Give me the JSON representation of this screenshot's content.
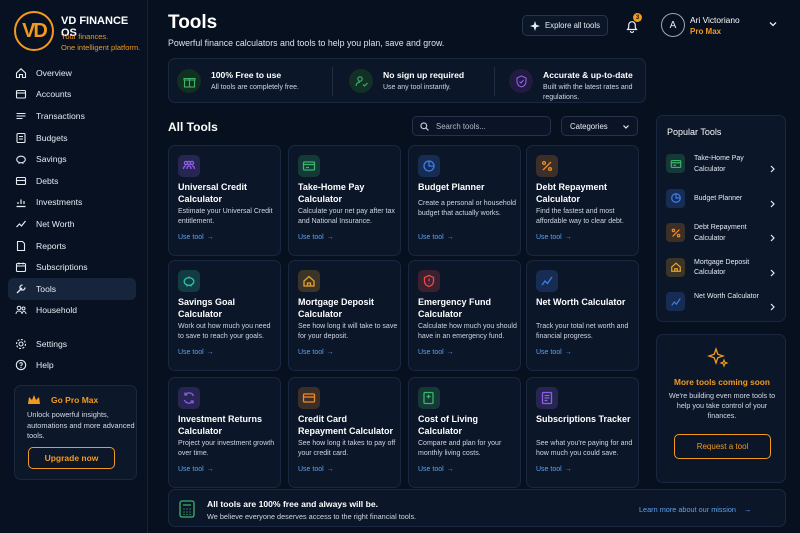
{
  "brand": {
    "logo": "VD",
    "name": "VD FINANCE OS",
    "tagline1": "Your finances.",
    "tagline2": "One intelligent platform."
  },
  "nav": [
    {
      "label": "Overview",
      "icon": "home-icon"
    },
    {
      "label": "Accounts",
      "icon": "wallet-icon"
    },
    {
      "label": "Transactions",
      "icon": "transactions-icon"
    },
    {
      "label": "Budgets",
      "icon": "budget-icon"
    },
    {
      "label": "Savings",
      "icon": "piggy-bank-icon"
    },
    {
      "label": "Debts",
      "icon": "debt-icon"
    },
    {
      "label": "Investments",
      "icon": "chart-icon"
    },
    {
      "label": "Net Worth",
      "icon": "networth-icon"
    },
    {
      "label": "Reports",
      "icon": "report-icon"
    },
    {
      "label": "Subscriptions",
      "icon": "calendar-icon"
    },
    {
      "label": "Tools",
      "icon": "wrench-icon",
      "active": true
    },
    {
      "label": "Household",
      "icon": "household-icon"
    }
  ],
  "nav_bottom": [
    {
      "label": "Settings",
      "icon": "gear-icon"
    },
    {
      "label": "Help",
      "icon": "help-icon"
    }
  ],
  "promo": {
    "title": "Go Pro Max",
    "text": "Unlock powerful insights, automations and more advanced tools.",
    "button": "Upgrade now"
  },
  "header": {
    "title": "Tools",
    "subtitle": "Powerful finance calculators and tools to help you plan, save and grow.",
    "explore": "Explore all tools",
    "notifications": "3",
    "avatar": "A",
    "user": "Ari Victoriano",
    "plan": "Pro Max"
  },
  "benefits": [
    {
      "title": "100% Free to use",
      "text": "All tools are completely free."
    },
    {
      "title": "No sign up required",
      "text": "Use any tool instantly."
    },
    {
      "title": "Accurate & up-to-date",
      "text": "Built with the latest rates and regulations."
    }
  ],
  "tools_section": {
    "title": "All Tools",
    "search_placeholder": "Search tools...",
    "categories": "Categories",
    "use_label": "Use tool"
  },
  "tools": [
    {
      "title": "Universal Credit Calculator",
      "desc": "Estimate your Universal Credit entitlement.",
      "color": "#8e5ee8"
    },
    {
      "title": "Take-Home Pay Calculator",
      "desc": "Calculate your net pay after tax and National Insurance.",
      "color": "#3ab56b"
    },
    {
      "title": "Budget Planner",
      "desc": "Create a personal or household budget that actually works.",
      "color": "#3f7de8"
    },
    {
      "title": "Debt Repayment Calculator",
      "desc": "Find the fastest and most affordable way to clear debt.",
      "color": "#ef8a2a"
    },
    {
      "title": "Savings Goal Calculator",
      "desc": "Work out how much you need to save to reach your goals.",
      "color": "#2fbfa6"
    },
    {
      "title": "Mortgage Deposit Calculator",
      "desc": "See how long it will take to save for your deposit.",
      "color": "#e8a22a"
    },
    {
      "title": "Emergency Fund Calculator",
      "desc": "Calculate how much you should have in an emergency fund.",
      "color": "#e8494a"
    },
    {
      "title": "Net Worth Calculator",
      "desc": "Track your total net worth and financial progress.",
      "color": "#3f7de8"
    },
    {
      "title": "Investment Returns Calculator",
      "desc": "Project your investment growth over time.",
      "color": "#8e5ee8"
    },
    {
      "title": "Credit Card Repayment Calculator",
      "desc": "See how long it takes to pay off your credit card.",
      "color": "#ef8a2a"
    },
    {
      "title": "Cost of Living Calculator",
      "desc": "Compare and plan for your monthly living costs.",
      "color": "#3ab56b"
    },
    {
      "title": "Subscriptions Tracker",
      "desc": "See what you're paying for and how much you could save.",
      "color": "#8e5ee8"
    }
  ],
  "popular": {
    "title": "Popular Tools",
    "items": [
      {
        "label": "Take-Home Pay Calculator",
        "color": "#3ab56b"
      },
      {
        "label": "Budget Planner",
        "color": "#3f7de8"
      },
      {
        "label": "Debt Repayment Calculator",
        "color": "#ef8a2a"
      },
      {
        "label": "Mortgage Deposit Calculator",
        "color": "#e8a22a"
      },
      {
        "label": "Net Worth Calculator",
        "color": "#3f7de8"
      }
    ]
  },
  "coming": {
    "title": "More tools coming soon",
    "text": "We're building even more tools to help you take control of your finances.",
    "button": "Request a tool"
  },
  "footer": {
    "title": "All tools are 100% free and always will be.",
    "text": "We believe everyone deserves access to the right financial tools.",
    "link": "Learn more about our mission"
  },
  "colors": {
    "accent": "#f39a1e",
    "link": "#5ea2f2",
    "background": "#07101f"
  }
}
